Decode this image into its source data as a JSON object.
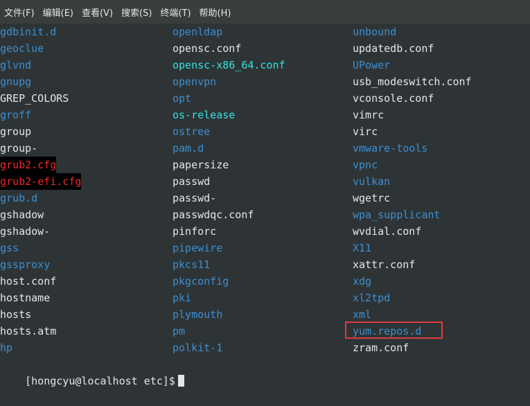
{
  "menu": [
    {
      "label": "文件(F)"
    },
    {
      "label": "编辑(E)"
    },
    {
      "label": "查看(V)"
    },
    {
      "label": "搜索(S)"
    },
    {
      "label": "终端(T)"
    },
    {
      "label": "帮助(H)"
    }
  ],
  "colors": {
    "directory": "#3e8ed0",
    "file": "#e6e6e6",
    "symlink": "#34e2e2",
    "highlight": "#ef2929",
    "annotation_box": "#e03c3c"
  },
  "listing": {
    "col0": [
      {
        "name": "gdbinit.d",
        "type": "dir"
      },
      {
        "name": "geoclue",
        "type": "dir"
      },
      {
        "name": "glvnd",
        "type": "dir"
      },
      {
        "name": "gnupg",
        "type": "dir"
      },
      {
        "name": "GREP_COLORS",
        "type": "file"
      },
      {
        "name": "groff",
        "type": "dir"
      },
      {
        "name": "group",
        "type": "file"
      },
      {
        "name": "group-",
        "type": "file"
      },
      {
        "name": "grub2.cfg",
        "type": "alert"
      },
      {
        "name": "grub2-efi.cfg",
        "type": "alert"
      },
      {
        "name": "grub.d",
        "type": "dir"
      },
      {
        "name": "gshadow",
        "type": "file"
      },
      {
        "name": "gshadow-",
        "type": "file"
      },
      {
        "name": "gss",
        "type": "dir"
      },
      {
        "name": "gssproxy",
        "type": "dir"
      },
      {
        "name": "host.conf",
        "type": "file"
      },
      {
        "name": "hostname",
        "type": "file"
      },
      {
        "name": "hosts",
        "type": "file"
      },
      {
        "name": "hosts.atm",
        "type": "file"
      },
      {
        "name": "hp",
        "type": "dir"
      }
    ],
    "col1": [
      {
        "name": "openldap",
        "type": "dir"
      },
      {
        "name": "opensc.conf",
        "type": "file"
      },
      {
        "name": "opensc-x86_64.conf",
        "type": "link"
      },
      {
        "name": "openvpn",
        "type": "dir"
      },
      {
        "name": "opt",
        "type": "dir"
      },
      {
        "name": "os-release",
        "type": "link"
      },
      {
        "name": "ostree",
        "type": "dir"
      },
      {
        "name": "pam.d",
        "type": "dir"
      },
      {
        "name": "papersize",
        "type": "file"
      },
      {
        "name": "passwd",
        "type": "file"
      },
      {
        "name": "passwd-",
        "type": "file"
      },
      {
        "name": "passwdqc.conf",
        "type": "file"
      },
      {
        "name": "pinforc",
        "type": "file"
      },
      {
        "name": "pipewire",
        "type": "dir"
      },
      {
        "name": "pkcs11",
        "type": "dir"
      },
      {
        "name": "pkgconfig",
        "type": "dir"
      },
      {
        "name": "pki",
        "type": "dir"
      },
      {
        "name": "plymouth",
        "type": "dir"
      },
      {
        "name": "pm",
        "type": "dir"
      },
      {
        "name": "polkit-1",
        "type": "dir"
      }
    ],
    "col2": [
      {
        "name": "unbound",
        "type": "dir"
      },
      {
        "name": "updatedb.conf",
        "type": "file"
      },
      {
        "name": "UPower",
        "type": "dir"
      },
      {
        "name": "usb_modeswitch.conf",
        "type": "file"
      },
      {
        "name": "vconsole.conf",
        "type": "file"
      },
      {
        "name": "vimrc",
        "type": "file"
      },
      {
        "name": "virc",
        "type": "file"
      },
      {
        "name": "vmware-tools",
        "type": "dir"
      },
      {
        "name": "vpnc",
        "type": "dir"
      },
      {
        "name": "vulkan",
        "type": "dir"
      },
      {
        "name": "wgetrc",
        "type": "file"
      },
      {
        "name": "wpa_supplicant",
        "type": "dir"
      },
      {
        "name": "wvdial.conf",
        "type": "file"
      },
      {
        "name": "X11",
        "type": "dir"
      },
      {
        "name": "xattr.conf",
        "type": "file"
      },
      {
        "name": "xdg",
        "type": "dir"
      },
      {
        "name": "xl2tpd",
        "type": "dir"
      },
      {
        "name": "xml",
        "type": "dir"
      },
      {
        "name": "yum.repos.d",
        "type": "dir"
      },
      {
        "name": "zram.conf",
        "type": "file"
      }
    ]
  },
  "prompt": {
    "text": "[hongcyu@localhost etc]$"
  }
}
